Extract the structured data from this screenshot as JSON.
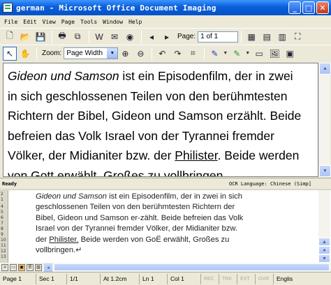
{
  "window": {
    "title": "german - Microsoft Office Document Imaging"
  },
  "menu": [
    "File",
    "Edit",
    "View",
    "Page",
    "Tools",
    "Window",
    "Help"
  ],
  "toolbar": {
    "page_label": "Page:",
    "page_value": "1 of 1",
    "zoom_label": "Zoom:",
    "zoom_value": "Page Width"
  },
  "modi_doc": {
    "italic_start": "Gideon und Samson",
    "line1_rest": " ist ein Episodenfilm, der in zwei",
    "line2": "in sich geschlossenen Teilen von den berühmtesten",
    "line3": "Richtern der Bibel, Gideon und Samson erzählt. Beide",
    "line4": "befreien das Volk Israel von der Tyrannei fremder",
    "line5_a": "Völker, der Midianiter bzw. der ",
    "line5_u": "Philister",
    "line5_b": ". Beide werden",
    "line6": "von Gott erwählt, Großes zu vollbringen."
  },
  "modi_status": {
    "ready": "Ready",
    "ocr": "OCR Language: Chinese (Simp]"
  },
  "word_doc": {
    "italic_start": "Gideon und Samson",
    "line1_rest": " ist ein Episodenfilm, der in zwei in sich",
    "line2": "geschlossenen Teilen von den berühmtesten Richtern der",
    "line3": "Bibel, Gideon und Samson er-zählt. Beide befreien das Volk",
    "line4": "Israel von der Tyrannei fremder Völker, der Midianiter bzw.",
    "line5_a": "der ",
    "line5_u": "Philister.",
    "line5_b": " Beide werden von GoË erwählt, Großes zu",
    "line6": "vollbringen.↵"
  },
  "ruler_marks": [
    "2",
    "1",
    "4",
    "5",
    "6",
    "7",
    "8",
    "9",
    "10",
    "11",
    "12",
    "13"
  ],
  "word_status": {
    "page": "Page 1",
    "sec": "Sec 1",
    "pages": "1/1",
    "at": "At 1.2cm",
    "ln": "Ln 1",
    "col": "Col 1",
    "rec": "REC",
    "trk": "TRK",
    "ext": "EXT",
    "ovr": "OVR",
    "lang": "Englis"
  }
}
